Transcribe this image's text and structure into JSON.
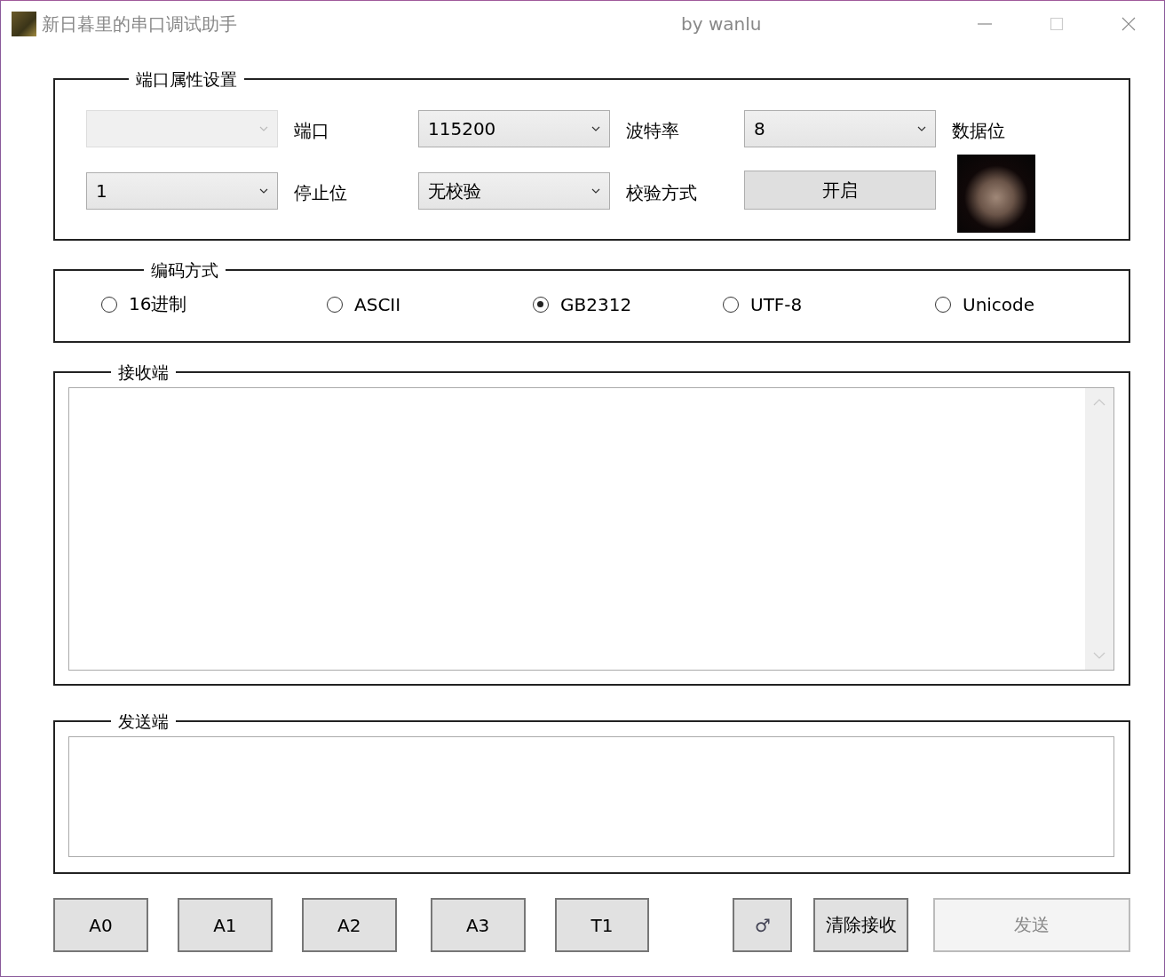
{
  "window": {
    "title": "新日暮里的串口调试助手",
    "subtitle": "by wanlu"
  },
  "port_settings": {
    "title": "端口属性设置",
    "rows": [
      [
        {
          "kind": "combo",
          "disabled": true
        },
        {
          "kind": "label",
          "text": "端口"
        },
        {
          "kind": "combo",
          "value": "115200",
          "disabled": false
        },
        {
          "kind": "label",
          "text": "波特率"
        },
        {
          "kind": "combo",
          "value": "8",
          "disabled": false
        },
        {
          "kind": "label",
          "text": "数据位"
        }
      ],
      [
        {
          "kind": "combo",
          "value": "1",
          "disabled": false
        },
        {
          "kind": "label",
          "text": "停止位"
        },
        {
          "kind": "combo",
          "value": "无校验",
          "disabled": false
        },
        {
          "kind": "label",
          "text": "校验方式"
        },
        {
          "kind": "button",
          "text": "开启",
          "disabled": false
        },
        {
          "kind": "photo"
        }
      ]
    ]
  },
  "encoding": {
    "title": "编码方式",
    "options": [
      {
        "label": "16进制",
        "selected": false
      },
      {
        "label": "ASCII",
        "selected": false
      },
      {
        "label": "GB2312",
        "selected": true
      },
      {
        "label": "UTF-8",
        "selected": false
      },
      {
        "label": "Unicode",
        "selected": false
      }
    ]
  },
  "receive": {
    "title": "接收端"
  },
  "send": {
    "title": "发送端"
  },
  "buttons": [
    {
      "label": "A0",
      "disabled": false,
      "kind": "short"
    },
    {
      "label": "A1",
      "disabled": false,
      "kind": "short"
    },
    {
      "label": "A2",
      "disabled": false,
      "kind": "short"
    },
    {
      "label": "A3",
      "disabled": false,
      "kind": "short"
    },
    {
      "label": "T1",
      "disabled": false,
      "kind": "short"
    },
    {
      "label": "♂",
      "disabled": false,
      "kind": "icon"
    },
    {
      "label": "清除接收",
      "disabled": false,
      "kind": "short"
    },
    {
      "label": "发送",
      "disabled": true,
      "kind": "wide"
    }
  ]
}
